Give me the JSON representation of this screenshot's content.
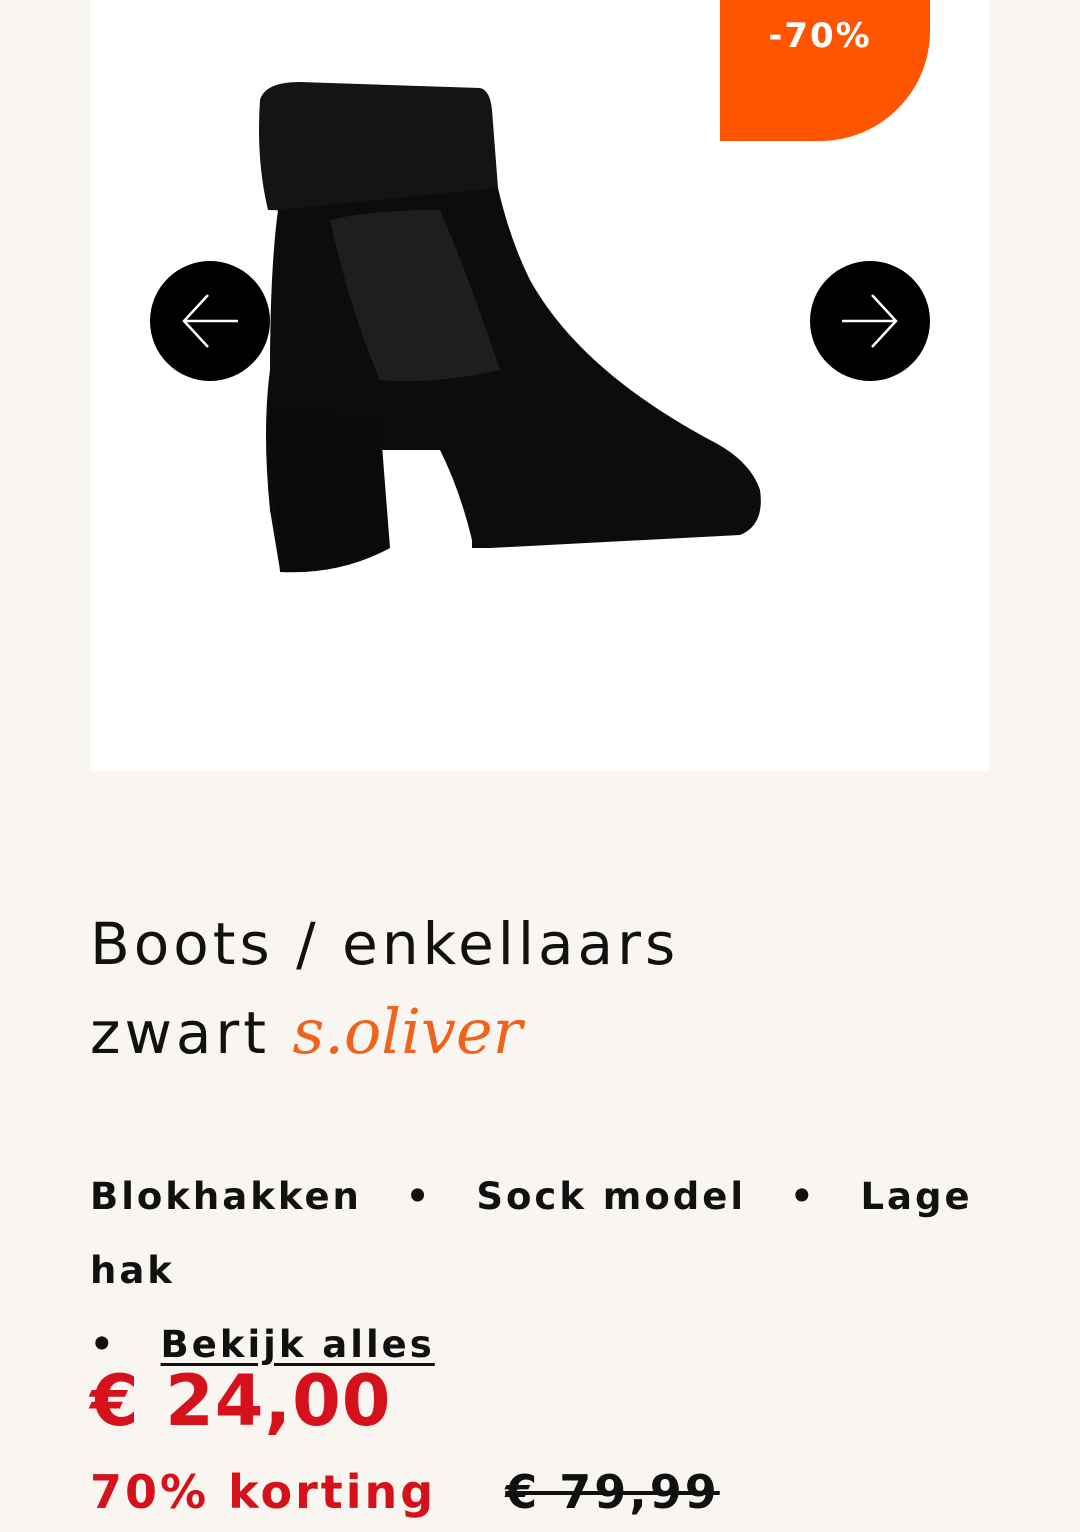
{
  "product": {
    "discount_badge": "-70%",
    "title_line1": "Boots / enkellaars",
    "title_line2": "zwart",
    "brand": "s.oliver",
    "features": [
      "Blokhakken",
      "Sock model",
      "Lage hak"
    ],
    "see_all_link": "Bekijk alles",
    "price": "€ 24,00",
    "discount_text": "70% korting",
    "old_price": "€ 79,99"
  },
  "carousel": {
    "prev_icon": "arrow-left-icon",
    "next_icon": "arrow-right-icon"
  },
  "colors": {
    "badge": "#ff5500",
    "price": "#d5121b",
    "brand": "#f0631e",
    "background": "#f9f6f2"
  }
}
